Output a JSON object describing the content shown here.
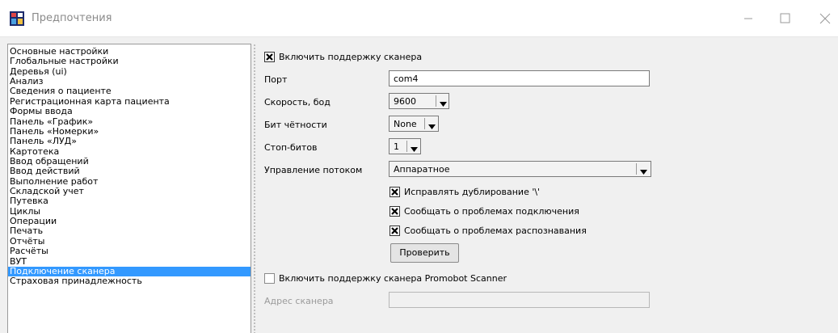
{
  "window": {
    "title": "Предпочтения",
    "icons": {
      "app": "app-icon",
      "minimize": "minimize-icon",
      "maximize": "maximize-icon",
      "close": "close-icon"
    }
  },
  "sidebar": {
    "items": [
      "Основные настройки",
      "Глобальные настройки",
      "Деревья (ui)",
      "Анализ",
      "Сведения о пациенте",
      "Регистрационная карта пациента",
      "Формы ввода",
      "Панель «График»",
      "Панель «Номерки»",
      "Панель «ЛУД»",
      "Картотека",
      "Ввод обращений",
      "Ввод действий",
      "Выполнение работ",
      "Складской учет",
      "Путевка",
      "Циклы",
      "Операции",
      "Печать",
      "Отчёты",
      "Расчёты",
      "ВУТ",
      "Подключение сканера",
      "Страховая принадлежность"
    ],
    "selected_index": 22,
    "selection_color": "#3399ff"
  },
  "scanner": {
    "enable_label": "Включить поддержку сканера",
    "enable_checked": true,
    "port_label": "Порт",
    "port_value": "com4",
    "baud_label": "Скорость, бод",
    "baud_value": "9600",
    "parity_label": "Бит чётности",
    "parity_value": "None",
    "stopbits_label": "Стоп-битов",
    "stopbits_value": "1",
    "flow_label": "Управление потоком",
    "flow_value": "Аппаратное",
    "fix_dup_label": "Исправлять дублирование '\\'",
    "fix_dup_checked": true,
    "report_conn_label": "Сообщать о проблемах подключения",
    "report_conn_checked": true,
    "report_recog_label": "Сообщать о проблемах распознавания",
    "report_recog_checked": true,
    "check_button": "Проверить"
  },
  "promobot": {
    "enable_label": "Включить поддержку сканера Promobot Scanner",
    "enable_checked": false,
    "address_label": "Адрес сканера",
    "address_value": ""
  }
}
